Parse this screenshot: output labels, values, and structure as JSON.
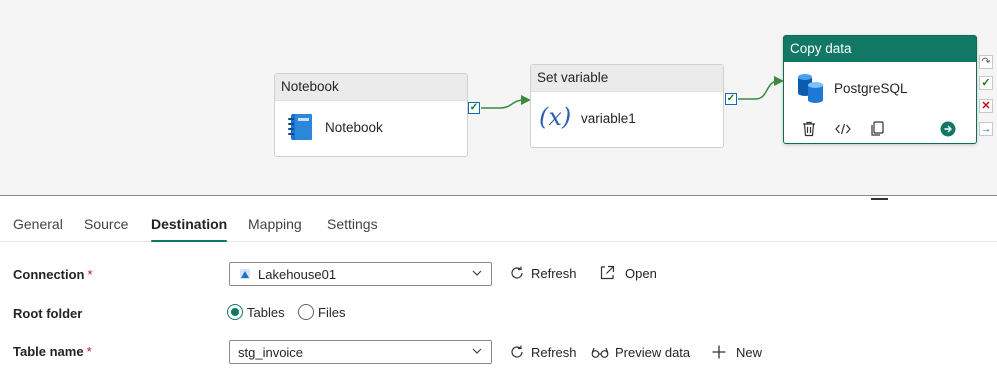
{
  "pipeline": {
    "nodes": [
      {
        "header": "Notebook",
        "label": "Notebook",
        "icon": "notebook-icon"
      },
      {
        "header": "Set variable",
        "label": "variable1",
        "icon": "variable-icon",
        "glyph": "(x)"
      },
      {
        "header": "Copy data",
        "label": "PostgreSQL",
        "icon": "postgresql-database-icon"
      }
    ],
    "colors": {
      "accent": "#117865",
      "success": "#107c10",
      "fail": "#c50f1f",
      "link": "#0f6cbd",
      "connector": "#3b8a3e"
    }
  },
  "tabs": [
    {
      "label": "General"
    },
    {
      "label": "Source"
    },
    {
      "label": "Destination",
      "active": true
    },
    {
      "label": "Mapping"
    },
    {
      "label": "Settings"
    }
  ],
  "form": {
    "connection": {
      "label": "Connection",
      "required": "*",
      "value": "Lakehouse01",
      "refresh": "Refresh",
      "open": "Open"
    },
    "root_folder": {
      "label": "Root folder",
      "options": [
        "Tables",
        "Files"
      ],
      "selected": "Tables"
    },
    "table_name": {
      "label": "Table name",
      "required": "*",
      "value": "stg_invoice",
      "refresh": "Refresh",
      "preview": "Preview data",
      "new": "New"
    }
  }
}
